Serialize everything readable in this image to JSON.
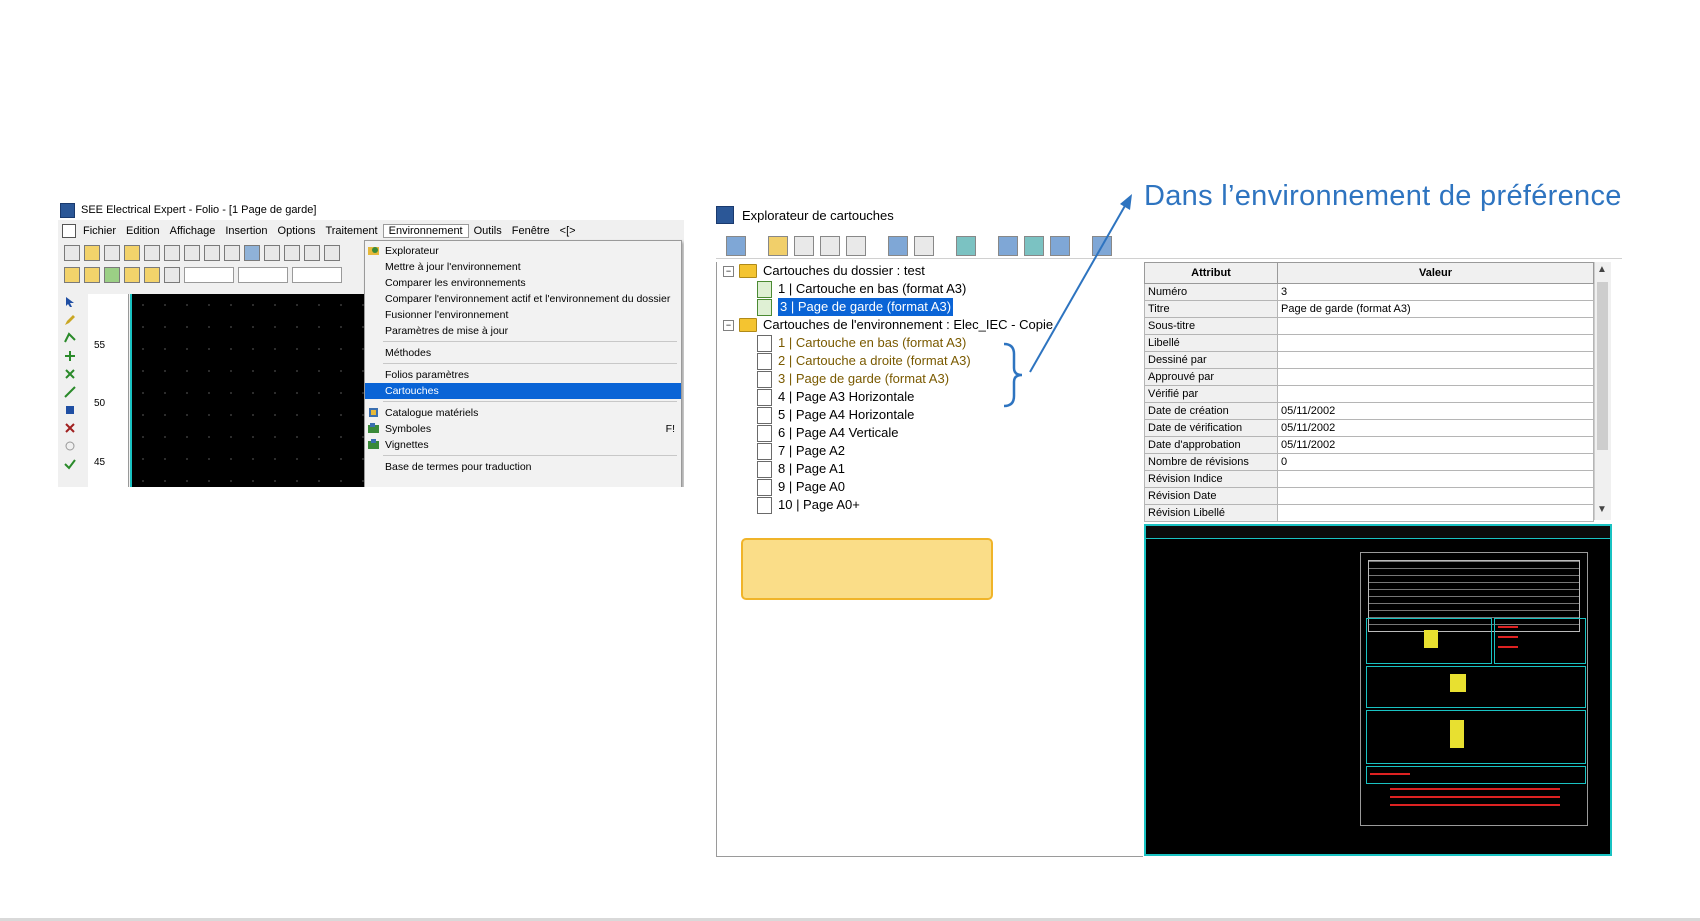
{
  "annotation": {
    "text": "Dans l’environnement de préférence",
    "color": "#2e74c0"
  },
  "app_window": {
    "title": "SEE Electrical Expert - Folio - [1 Page de garde]",
    "menu": [
      "Fichier",
      "Edition",
      "Affichage",
      "Insertion",
      "Options",
      "Traitement",
      "Environnement",
      "Outils",
      "Fenêtre",
      "<[>"
    ],
    "active_menu": "Environnement",
    "ruler_numbers": [
      "55",
      "50",
      "45"
    ],
    "dropdown": {
      "items": [
        {
          "label": "Explorateur",
          "icon": "explorer-icon"
        },
        {
          "label": "Mettre à jour l'environnement"
        },
        {
          "label": "Comparer les environnements"
        },
        {
          "label": "Comparer l'environnement actif et l'environnement du dossier"
        },
        {
          "label": "Fusionner l'environnement"
        },
        {
          "label": "Paramètres de mise à jour"
        },
        {
          "label": "Méthodes"
        },
        {
          "label": "Folios paramètres"
        },
        {
          "label": "Cartouches",
          "selected": true
        },
        {
          "label": "Catalogue matériels",
          "icon": "catalog-icon"
        },
        {
          "label": "Symboles",
          "icon": "symbols-icon",
          "shortcut": "F!"
        },
        {
          "label": "Vignettes",
          "icon": "thumbnails-icon"
        },
        {
          "label": "Base de termes pour traduction"
        }
      ]
    }
  },
  "explorer": {
    "title": "Explorateur de cartouches",
    "tree": {
      "folder1": {
        "label": "Cartouches du dossier : test",
        "items": [
          "1 | Cartouche en bas (format A3)",
          "3 | Page de garde (format A3)"
        ],
        "selected_index": 1
      },
      "folder2": {
        "label": "Cartouches de l'environnement : Elec_IEC - Copie",
        "items": [
          "1 | Cartouche en bas (format A3)",
          "2 | Cartouche a droite (format A3)",
          "3 | Page de garde (format A3)",
          "4 | Page A3 Horizontale",
          "5 | Page A4 Horizontale",
          "6 | Page A4 Verticale",
          "7 | Page A2",
          "8 | Page A1",
          "9 | Page A0",
          "10 | Page A0+"
        ],
        "highlighted_count": 3
      }
    },
    "attributes": {
      "header_attr": "Attribut",
      "header_value": "Valeur",
      "rows": [
        {
          "k": "Numéro",
          "v": "3"
        },
        {
          "k": "Titre",
          "v": "Page de garde (format A3)"
        },
        {
          "k": "Sous-titre",
          "v": ""
        },
        {
          "k": "Libellé",
          "v": ""
        },
        {
          "k": "Dessiné par",
          "v": ""
        },
        {
          "k": "Approuvé par",
          "v": ""
        },
        {
          "k": "Vérifié par",
          "v": ""
        },
        {
          "k": "Date de création",
          "v": "05/11/2002"
        },
        {
          "k": "Date de vérification",
          "v": "05/11/2002"
        },
        {
          "k": "Date d'approbation",
          "v": "05/11/2002"
        },
        {
          "k": "Nombre de révisions",
          "v": "0"
        },
        {
          "k": "Révision Indice",
          "v": ""
        },
        {
          "k": "Révision Date",
          "v": ""
        },
        {
          "k": "Révision Libellé",
          "v": ""
        }
      ]
    }
  }
}
